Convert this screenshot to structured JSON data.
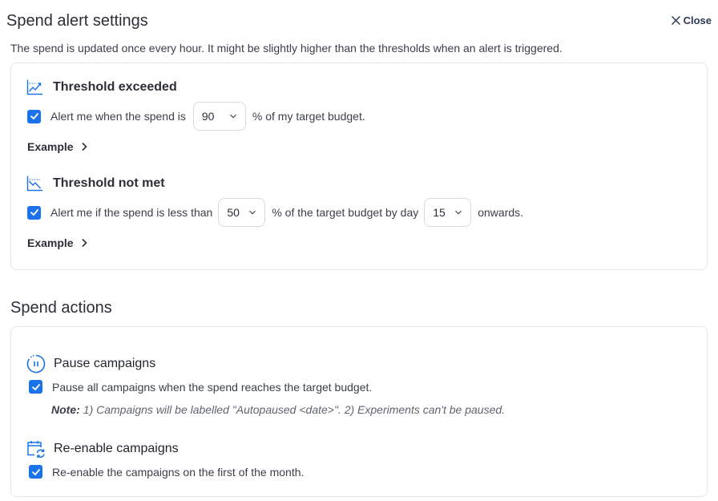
{
  "header": {
    "title": "Spend alert settings",
    "close_label": "Close",
    "subtitle": "The spend is updated once every hour. It might be slightly higher than the thresholds when an alert is triggered."
  },
  "threshold_exceeded": {
    "heading": "Threshold exceeded",
    "checked": true,
    "text_before": "Alert me when the spend is",
    "percent_value": "90",
    "text_after": "% of my target budget.",
    "example_label": "Example"
  },
  "threshold_not_met": {
    "heading": "Threshold not met",
    "checked": true,
    "text_before": "Alert me if the spend is less than",
    "percent_value": "50",
    "text_middle": "% of the target budget by day",
    "day_value": "15",
    "text_after": "onwards.",
    "example_label": "Example"
  },
  "spend_actions": {
    "heading": "Spend actions",
    "pause": {
      "heading": "Pause campaigns",
      "checked": true,
      "label": "Pause all campaigns when the spend reaches the target budget.",
      "note_label": "Note:",
      "note_text": "1) Campaigns will be labelled \"Autopaused <date>\". 2) Experiments can't be paused."
    },
    "reenable": {
      "heading": "Re-enable campaigns",
      "checked": true,
      "label": "Re-enable the campaigns on the first of the month."
    }
  },
  "colors": {
    "accent": "#1a73e8",
    "border": "#e3e6ea",
    "text": "#2b2f36"
  },
  "icons": {
    "close": "close-icon",
    "threshold_exceeded": "chart-up-icon",
    "threshold_not_met": "chart-down-icon",
    "pause": "pause-circle-icon",
    "reenable": "calendar-refresh-icon",
    "checkbox": "check-icon",
    "dropdown": "chevron-down-icon",
    "example": "chevron-right-icon"
  }
}
